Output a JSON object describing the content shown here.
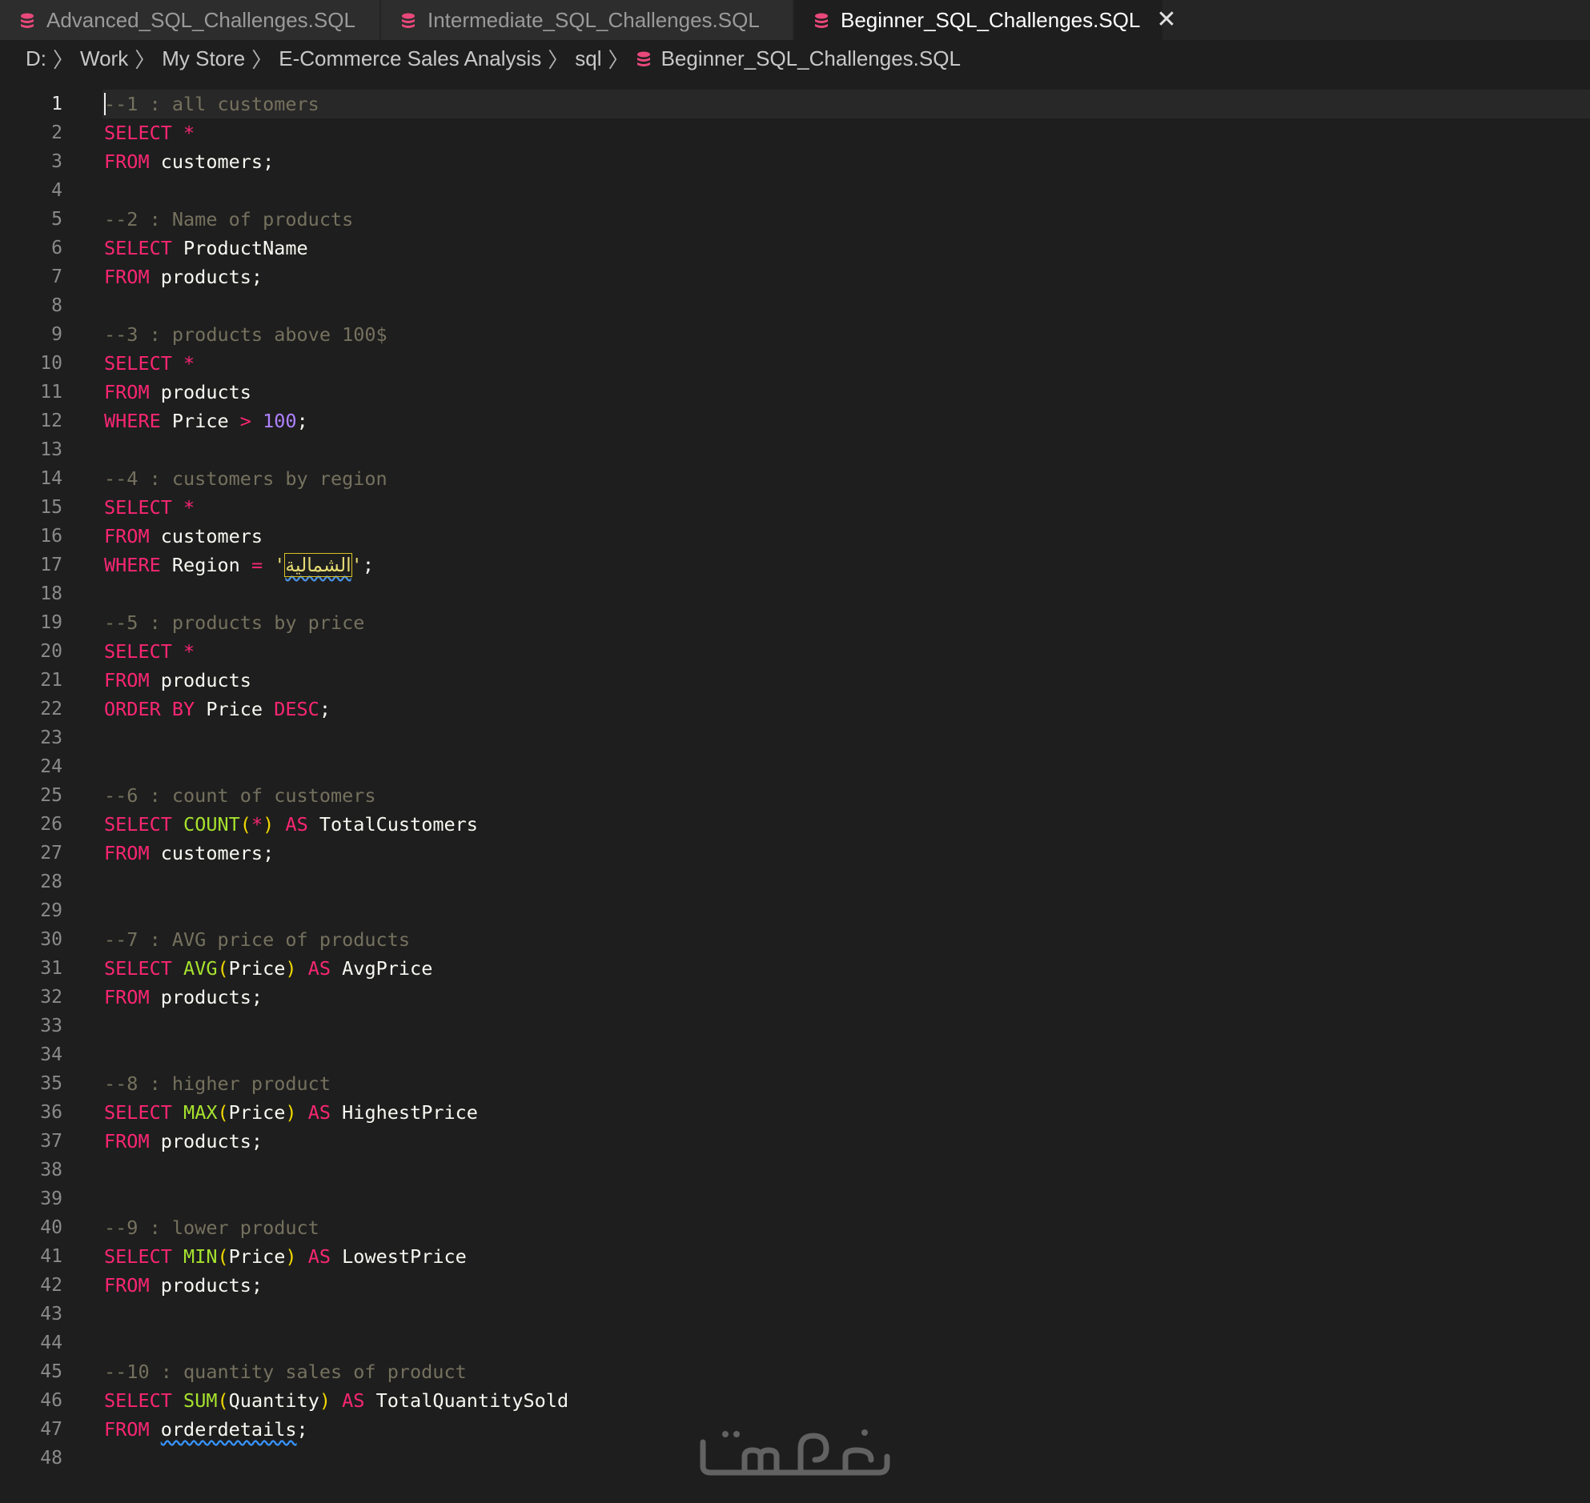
{
  "tabs": [
    {
      "label": "Advanced_SQL_Challenges.SQL",
      "active": false,
      "icon": "database-icon"
    },
    {
      "label": "Intermediate_SQL_Challenges.SQL",
      "active": false,
      "icon": "database-icon"
    },
    {
      "label": "Beginner_SQL_Challenges.SQL",
      "active": true,
      "icon": "database-icon",
      "close_glyph": "✕"
    }
  ],
  "breadcrumb": {
    "items": [
      "D:",
      "Work",
      "My Store",
      "E-Commerce Sales Analysis",
      "sql",
      "Beginner_SQL_Challenges.SQL"
    ],
    "separator": "〉"
  },
  "editor": {
    "active_line": 1,
    "lines": [
      {
        "n": "1",
        "tokens": [
          [
            "comment",
            "--1 : all customers"
          ]
        ]
      },
      {
        "n": "2",
        "tokens": [
          [
            "kw",
            "SELECT"
          ],
          [
            "id",
            " "
          ],
          [
            "kw",
            "*"
          ]
        ]
      },
      {
        "n": "3",
        "tokens": [
          [
            "kw",
            "FROM"
          ],
          [
            "id",
            " customers;"
          ]
        ]
      },
      {
        "n": "4",
        "tokens": []
      },
      {
        "n": "5",
        "tokens": [
          [
            "comment",
            "--2 : Name of products"
          ]
        ]
      },
      {
        "n": "6",
        "tokens": [
          [
            "kw",
            "SELECT"
          ],
          [
            "id",
            " ProductName"
          ]
        ]
      },
      {
        "n": "7",
        "tokens": [
          [
            "kw",
            "FROM"
          ],
          [
            "id",
            " products;"
          ]
        ]
      },
      {
        "n": "8",
        "tokens": []
      },
      {
        "n": "9",
        "tokens": [
          [
            "comment",
            "--3 : products above 100$"
          ]
        ]
      },
      {
        "n": "10",
        "tokens": [
          [
            "kw",
            "SELECT"
          ],
          [
            "id",
            " "
          ],
          [
            "kw",
            "*"
          ]
        ]
      },
      {
        "n": "11",
        "tokens": [
          [
            "kw",
            "FROM"
          ],
          [
            "id",
            " products"
          ]
        ]
      },
      {
        "n": "12",
        "tokens": [
          [
            "kw",
            "WHERE"
          ],
          [
            "id",
            " Price "
          ],
          [
            "kw",
            ">"
          ],
          [
            "id",
            " "
          ],
          [
            "num",
            "100"
          ],
          [
            "id",
            ";"
          ]
        ]
      },
      {
        "n": "13",
        "tokens": []
      },
      {
        "n": "14",
        "tokens": [
          [
            "comment",
            "--4 : customers by region"
          ]
        ]
      },
      {
        "n": "15",
        "tokens": [
          [
            "kw",
            "SELECT"
          ],
          [
            "id",
            " "
          ],
          [
            "kw",
            "*"
          ]
        ]
      },
      {
        "n": "16",
        "tokens": [
          [
            "kw",
            "FROM"
          ],
          [
            "id",
            " customers"
          ]
        ]
      },
      {
        "n": "17",
        "tokens": [
          [
            "kw",
            "WHERE"
          ],
          [
            "id",
            " Region "
          ],
          [
            "kw",
            "="
          ],
          [
            "id",
            " "
          ],
          [
            "str",
            "'"
          ],
          [
            "strbox",
            "الشمالية"
          ],
          [
            "str",
            "'"
          ],
          [
            "id",
            ";"
          ]
        ]
      },
      {
        "n": "18",
        "tokens": []
      },
      {
        "n": "19",
        "tokens": [
          [
            "comment",
            "--5 : products by price"
          ]
        ]
      },
      {
        "n": "20",
        "tokens": [
          [
            "kw",
            "SELECT"
          ],
          [
            "id",
            " "
          ],
          [
            "kw",
            "*"
          ]
        ]
      },
      {
        "n": "21",
        "tokens": [
          [
            "kw",
            "FROM"
          ],
          [
            "id",
            " products"
          ]
        ]
      },
      {
        "n": "22",
        "tokens": [
          [
            "kw",
            "ORDER BY"
          ],
          [
            "id",
            " Price "
          ],
          [
            "kw",
            "DESC"
          ],
          [
            "id",
            ";"
          ]
        ]
      },
      {
        "n": "23",
        "tokens": []
      },
      {
        "n": "24",
        "tokens": []
      },
      {
        "n": "25",
        "tokens": [
          [
            "comment",
            "--6 : count of customers"
          ]
        ]
      },
      {
        "n": "26",
        "tokens": [
          [
            "kw",
            "SELECT"
          ],
          [
            "id",
            " "
          ],
          [
            "fn",
            "COUNT"
          ],
          [
            "paren",
            "("
          ],
          [
            "kw",
            "*"
          ],
          [
            "paren",
            ")"
          ],
          [
            "id",
            " "
          ],
          [
            "kw",
            "AS"
          ],
          [
            "id",
            " TotalCustomers"
          ]
        ]
      },
      {
        "n": "27",
        "tokens": [
          [
            "kw",
            "FROM"
          ],
          [
            "id",
            " customers;"
          ]
        ]
      },
      {
        "n": "28",
        "tokens": []
      },
      {
        "n": "29",
        "tokens": []
      },
      {
        "n": "30",
        "tokens": [
          [
            "comment",
            "--7 : AVG price of products"
          ]
        ]
      },
      {
        "n": "31",
        "tokens": [
          [
            "kw",
            "SELECT"
          ],
          [
            "id",
            " "
          ],
          [
            "fn",
            "AVG"
          ],
          [
            "paren",
            "("
          ],
          [
            "id",
            "Price"
          ],
          [
            "paren",
            ")"
          ],
          [
            "id",
            " "
          ],
          [
            "kw",
            "AS"
          ],
          [
            "id",
            " AvgPrice"
          ]
        ]
      },
      {
        "n": "32",
        "tokens": [
          [
            "kw",
            "FROM"
          ],
          [
            "id",
            " products;"
          ]
        ]
      },
      {
        "n": "33",
        "tokens": []
      },
      {
        "n": "34",
        "tokens": []
      },
      {
        "n": "35",
        "tokens": [
          [
            "comment",
            "--8 : higher product"
          ]
        ]
      },
      {
        "n": "36",
        "tokens": [
          [
            "kw",
            "SELECT"
          ],
          [
            "id",
            " "
          ],
          [
            "fn",
            "MAX"
          ],
          [
            "paren",
            "("
          ],
          [
            "id",
            "Price"
          ],
          [
            "paren",
            ")"
          ],
          [
            "id",
            " "
          ],
          [
            "kw",
            "AS"
          ],
          [
            "id",
            " HighestPrice"
          ]
        ]
      },
      {
        "n": "37",
        "tokens": [
          [
            "kw",
            "FROM"
          ],
          [
            "id",
            " products;"
          ]
        ]
      },
      {
        "n": "38",
        "tokens": []
      },
      {
        "n": "39",
        "tokens": []
      },
      {
        "n": "40",
        "tokens": [
          [
            "comment",
            "--9 : lower product"
          ]
        ]
      },
      {
        "n": "41",
        "tokens": [
          [
            "kw",
            "SELECT"
          ],
          [
            "id",
            " "
          ],
          [
            "fn",
            "MIN"
          ],
          [
            "paren",
            "("
          ],
          [
            "id",
            "Price"
          ],
          [
            "paren",
            ")"
          ],
          [
            "id",
            " "
          ],
          [
            "kw",
            "AS"
          ],
          [
            "id",
            " LowestPrice"
          ]
        ]
      },
      {
        "n": "42",
        "tokens": [
          [
            "kw",
            "FROM"
          ],
          [
            "id",
            " products;"
          ]
        ]
      },
      {
        "n": "43",
        "tokens": []
      },
      {
        "n": "44",
        "tokens": []
      },
      {
        "n": "45",
        "tokens": [
          [
            "comment",
            "--10 : quantity sales of product"
          ]
        ]
      },
      {
        "n": "46",
        "tokens": [
          [
            "kw",
            "SELECT"
          ],
          [
            "id",
            " "
          ],
          [
            "fn",
            "SUM"
          ],
          [
            "paren",
            "("
          ],
          [
            "id",
            "Quantity"
          ],
          [
            "paren",
            ")"
          ],
          [
            "id",
            " "
          ],
          [
            "kw",
            "AS"
          ],
          [
            "id",
            " TotalQuantitySold"
          ]
        ]
      },
      {
        "n": "47",
        "tokens": [
          [
            "kw",
            "FROM"
          ],
          [
            "id",
            " "
          ],
          [
            "squiggle",
            "orderdetails"
          ],
          [
            "id",
            ";"
          ]
        ]
      },
      {
        "n": "48",
        "tokens": []
      }
    ]
  },
  "watermark": {
    "text": "خمسات",
    "icon": "khamsat-logo"
  },
  "colors": {
    "keyword": "#f92672",
    "function": "#a6e22e",
    "comment": "#75715e",
    "number": "#ae81ff",
    "string": "#e6db74",
    "bracket": "#f0d800",
    "icon_db": "#e8487a"
  }
}
